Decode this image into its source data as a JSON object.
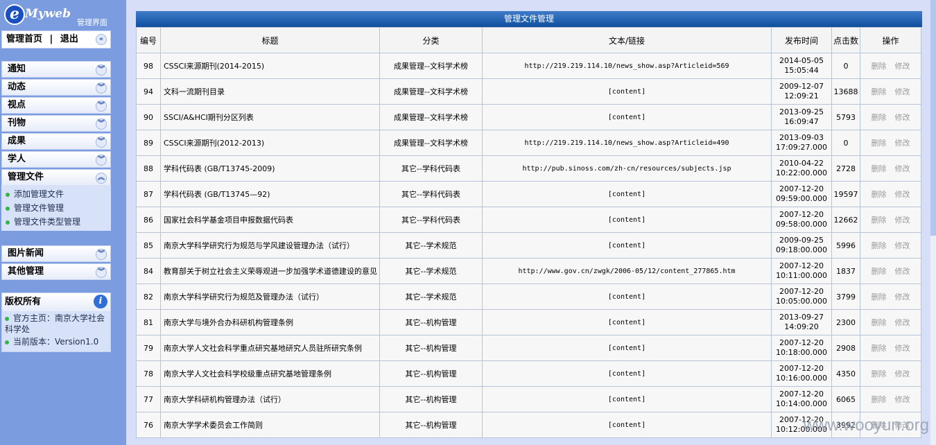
{
  "brand": {
    "logo_e": "e",
    "logo_my": "Myweb",
    "admin_label": "管理界面"
  },
  "nav_top": {
    "home": "管理首页",
    "sep": "|",
    "logout": "退出",
    "collapse_icon": "«"
  },
  "menus": [
    {
      "label": "通知"
    },
    {
      "label": "动态"
    },
    {
      "label": "视点"
    },
    {
      "label": "刊物"
    },
    {
      "label": "成果"
    },
    {
      "label": "学人"
    },
    {
      "label": "管理文件"
    }
  ],
  "submenu": [
    {
      "label": "添加管理文件"
    },
    {
      "label": "管理文件管理"
    },
    {
      "label": "管理文件类型管理"
    }
  ],
  "menus2": [
    {
      "label": "图片新闻"
    },
    {
      "label": "其他管理"
    }
  ],
  "copyright": {
    "title": "版权所有",
    "homepage": "官方主页：南京大学社会科学处",
    "version": "当前版本：Version1.0"
  },
  "main": {
    "title": "管理文件管理",
    "columns": [
      "编号",
      "标题",
      "分类",
      "文本/链接",
      "发布时间",
      "点击数",
      "操作"
    ],
    "op_delete": "删除",
    "op_edit": "修改",
    "rows": [
      {
        "id": "98",
        "title": "CSSCI来源期刊(2014-2015)",
        "category": "成果管理--文科学术榜",
        "link": "http://219.219.114.10/news_show.asp?Articleid=569",
        "date": "2014-05-05",
        "time": "15:05:44",
        "clicks": "0"
      },
      {
        "id": "94",
        "title": "文科一流期刊目录",
        "category": "成果管理--文科学术榜",
        "link": "[content]",
        "date": "2009-12-07",
        "time": "12:09:21",
        "clicks": "13688"
      },
      {
        "id": "90",
        "title": "SSCI/A&HCI期刊分区列表",
        "category": "成果管理--文科学术榜",
        "link": "[content]",
        "date": "2013-09-25",
        "time": "16:09:47",
        "clicks": "5793"
      },
      {
        "id": "89",
        "title": "CSSCI来源期刊(2012-2013)",
        "category": "成果管理--文科学术榜",
        "link": "http://219.219.114.10/news_show.asp?Articleid=490",
        "date": "2013-09-03",
        "time": "17:09:27.000",
        "clicks": "0"
      },
      {
        "id": "88",
        "title": "学科代码表 (GB/T13745-2009)",
        "category": "其它--学科代码表",
        "link": "http://pub.sinoss.com/zh-cn/resources/subjects.jsp",
        "date": "2010-04-22",
        "time": "10:22:00.000",
        "clicks": "2728"
      },
      {
        "id": "87",
        "title": "学科代码表 (GB/T13745—92)",
        "category": "其它--学科代码表",
        "link": "[content]",
        "date": "2007-12-20",
        "time": "09:59:00.000",
        "clicks": "19597"
      },
      {
        "id": "86",
        "title": "国家社会科学基金项目申报数据代码表",
        "category": "其它--学科代码表",
        "link": "[content]",
        "date": "2007-12-20",
        "time": "09:58:00.000",
        "clicks": "12662"
      },
      {
        "id": "85",
        "title": "南京大学科学研究行为规范与学风建设管理办法（试行）",
        "category": "其它--学术规范",
        "link": "[content]",
        "date": "2009-09-25",
        "time": "09:18:00.000",
        "clicks": "5996"
      },
      {
        "id": "84",
        "title": "教育部关于树立社会主义荣辱观进一步加强学术道德建设的意见",
        "category": "其它--学术规范",
        "link": "http://www.gov.cn/zwgk/2006-05/12/content_277865.htm",
        "date": "2007-12-20",
        "time": "10:11:00.000",
        "clicks": "1837"
      },
      {
        "id": "82",
        "title": "南京大学科学研究行为规范及管理办法（试行）",
        "category": "其它--学术规范",
        "link": "[content]",
        "date": "2007-12-20",
        "time": "10:05:00.000",
        "clicks": "3799"
      },
      {
        "id": "81",
        "title": "南京大学与境外合办科研机构管理条例",
        "category": "其它--机构管理",
        "link": "[content]",
        "date": "2013-09-27",
        "time": "14:09:20",
        "clicks": "2300"
      },
      {
        "id": "79",
        "title": "南京大学人文社会科学重点研究基地研究人员驻所研究条例",
        "category": "其它--机构管理",
        "link": "[content]",
        "date": "2007-12-20",
        "time": "10:18:00.000",
        "clicks": "2908"
      },
      {
        "id": "78",
        "title": "南京大学人文社会科学校级重点研究基地管理条例",
        "category": "其它--机构管理",
        "link": "[content]",
        "date": "2007-12-20",
        "time": "10:16:00.000",
        "clicks": "4350"
      },
      {
        "id": "77",
        "title": "南京大学科研机构管理办法（试行）",
        "category": "其它--机构管理",
        "link": "[content]",
        "date": "2007-12-20",
        "time": "10:14:00.000",
        "clicks": "6065"
      },
      {
        "id": "76",
        "title": "南京大学学术委员会工作简则",
        "category": "其它--机构管理",
        "link": "[content]",
        "date": "2007-12-20",
        "time": "10:12:00.000",
        "clicks": "3992"
      }
    ]
  },
  "watermark": "www.wooyun.org"
}
